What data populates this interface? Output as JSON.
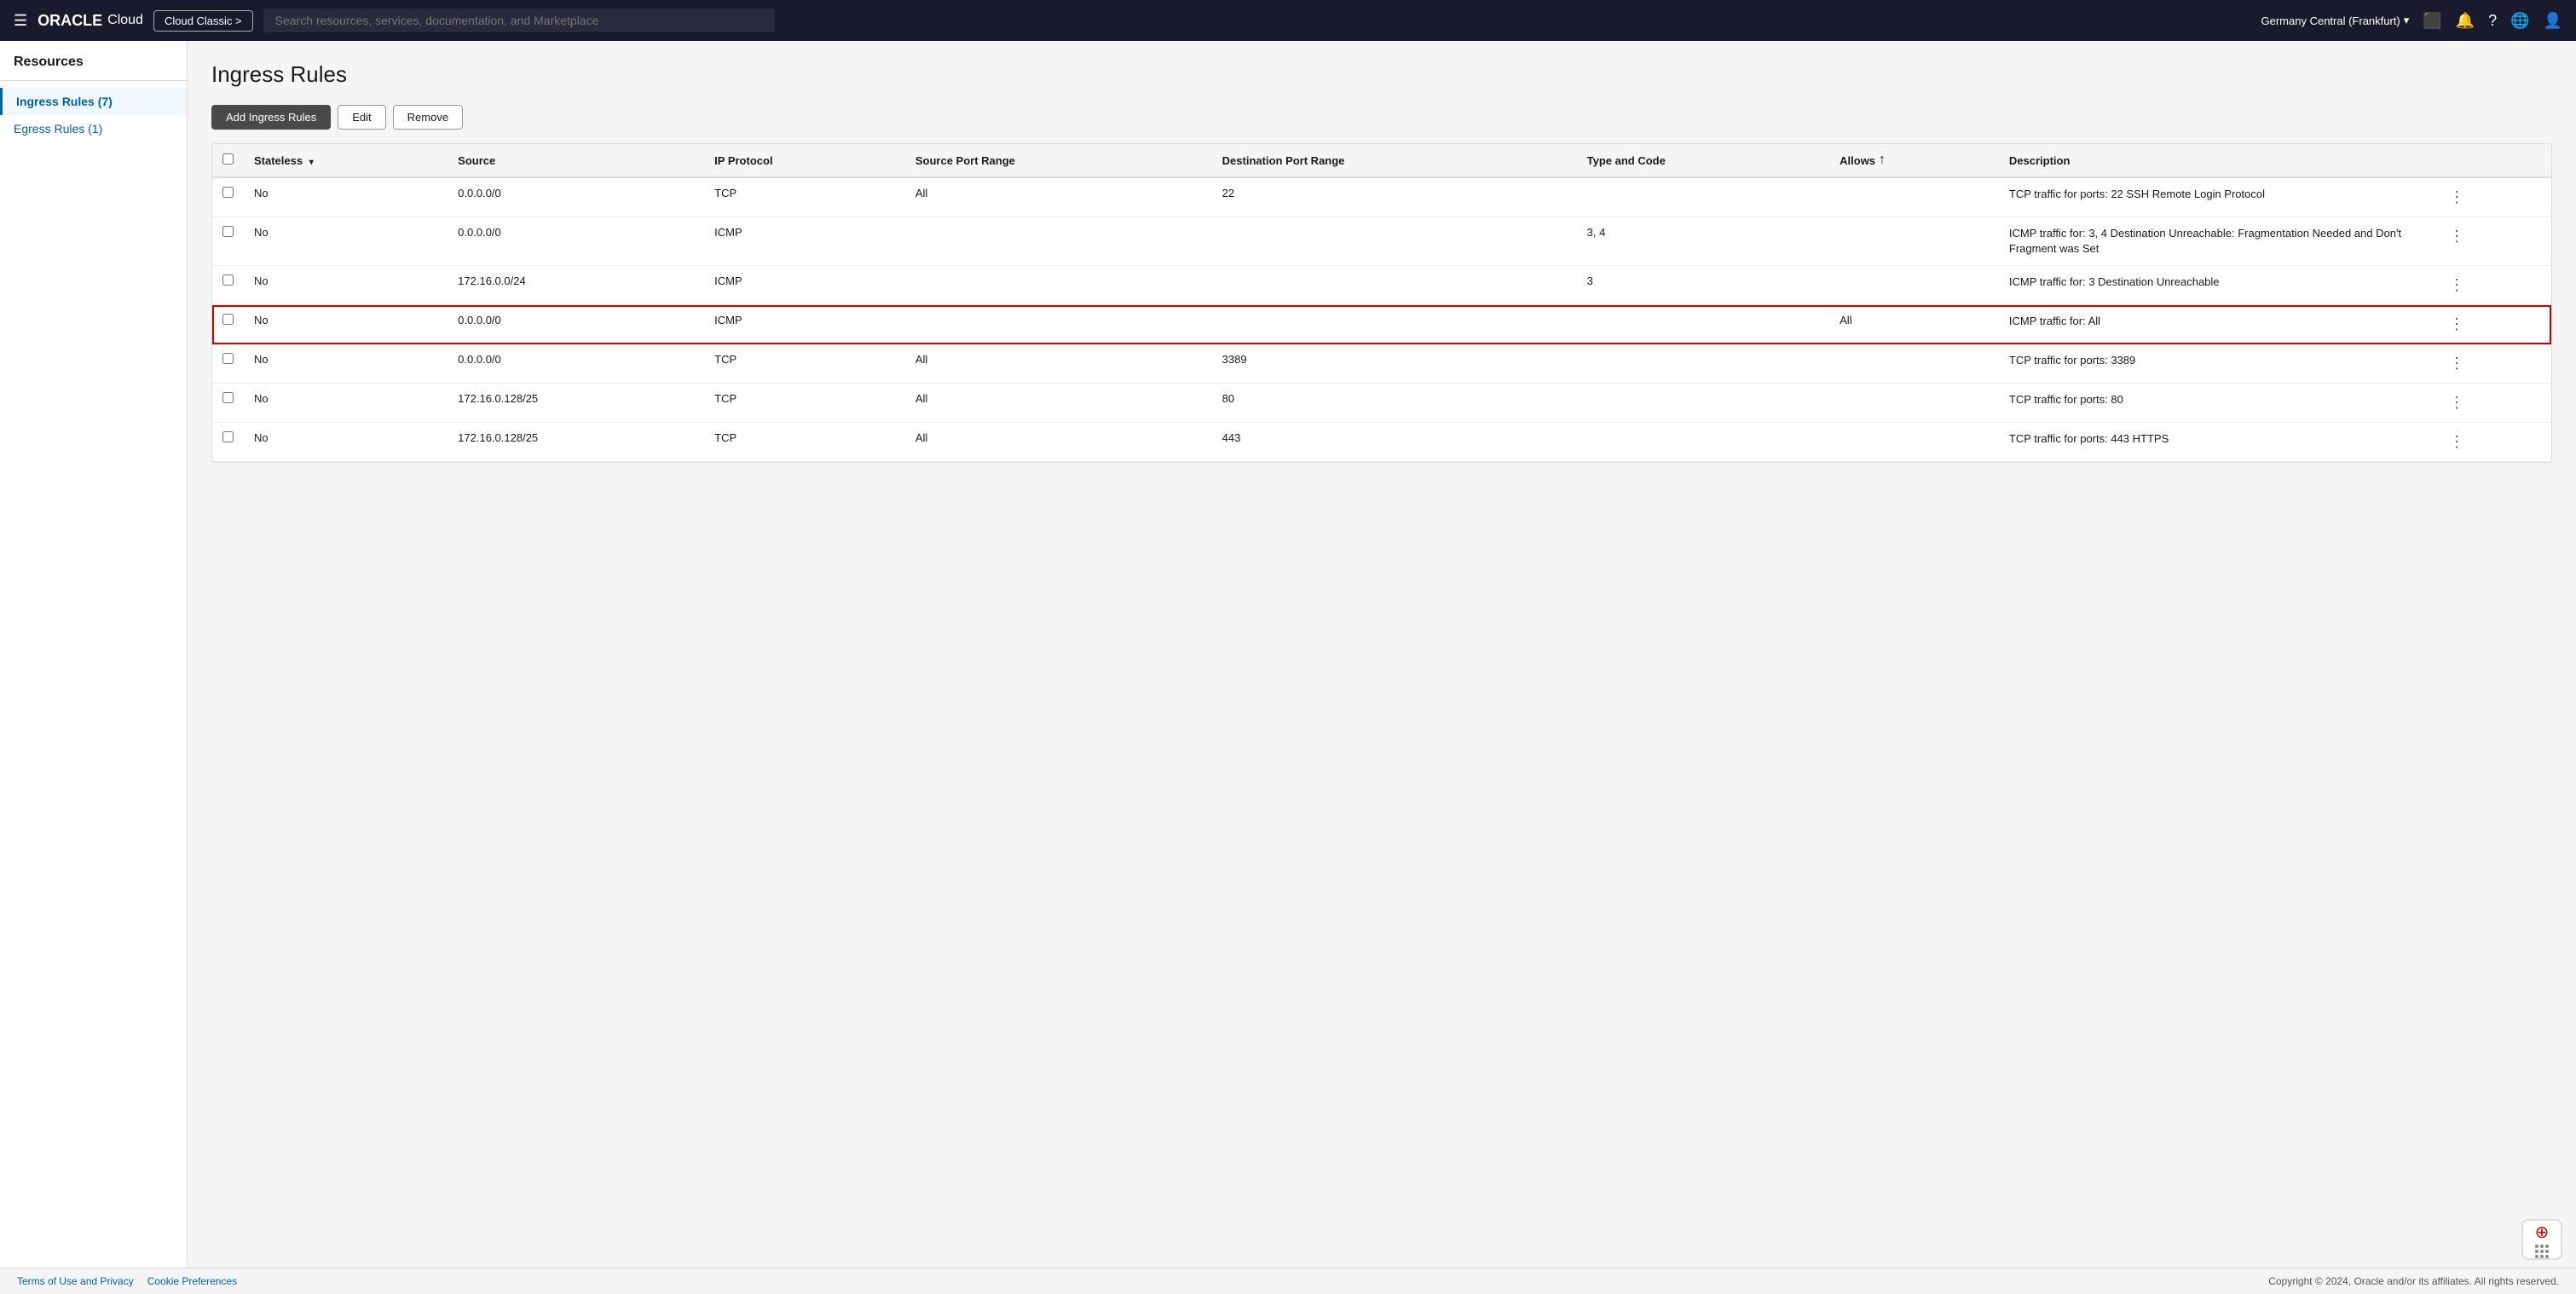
{
  "nav": {
    "hamburger": "☰",
    "oracle_logo": "ORACLE Cloud",
    "cloud_classic_btn": "Cloud Classic >",
    "search_placeholder": "Search resources, services, documentation, and Marketplace",
    "region": "Germany Central (Frankfurt)",
    "region_chevron": "▾"
  },
  "sidebar": {
    "title": "Resources",
    "items": [
      {
        "id": "ingress-rules",
        "label": "Ingress Rules (7)",
        "active": true
      },
      {
        "id": "egress-rules",
        "label": "Egress Rules (1)",
        "active": false
      }
    ]
  },
  "page": {
    "title": "Ingress Rules",
    "toolbar": {
      "add_label": "Add Ingress Rules",
      "edit_label": "Edit",
      "remove_label": "Remove"
    },
    "table": {
      "columns": [
        {
          "id": "checkbox",
          "label": ""
        },
        {
          "id": "stateless",
          "label": "Stateless",
          "sortable": true
        },
        {
          "id": "source",
          "label": "Source"
        },
        {
          "id": "ip_protocol",
          "label": "IP Protocol"
        },
        {
          "id": "source_port_range",
          "label": "Source Port Range"
        },
        {
          "id": "destination_port_range",
          "label": "Destination Port Range"
        },
        {
          "id": "type_and_code",
          "label": "Type and Code"
        },
        {
          "id": "allows",
          "label": "Allows"
        },
        {
          "id": "description",
          "label": "Description"
        },
        {
          "id": "actions",
          "label": ""
        }
      ],
      "rows": [
        {
          "id": 1,
          "stateless": "No",
          "source": "0.0.0.0/0",
          "ip_protocol": "TCP",
          "source_port_range": "All",
          "destination_port_range": "22",
          "type_and_code": "",
          "allows": "",
          "description": "TCP traffic for ports: 22 SSH Remote Login Protocol",
          "highlighted": false
        },
        {
          "id": 2,
          "stateless": "No",
          "source": "0.0.0.0/0",
          "ip_protocol": "ICMP",
          "source_port_range": "",
          "destination_port_range": "",
          "type_and_code": "3, 4",
          "allows": "",
          "description": "ICMP traffic for: 3, 4 Destination Unreachable: Fragmentation Needed and Don't Fragment was Set",
          "highlighted": false
        },
        {
          "id": 3,
          "stateless": "No",
          "source": "172.16.0.0/24",
          "ip_protocol": "ICMP",
          "source_port_range": "",
          "destination_port_range": "",
          "type_and_code": "3",
          "allows": "",
          "description": "ICMP traffic for: 3 Destination Unreachable",
          "highlighted": false
        },
        {
          "id": 4,
          "stateless": "No",
          "source": "0.0.0.0/0",
          "ip_protocol": "ICMP",
          "source_port_range": "",
          "destination_port_range": "",
          "type_and_code": "",
          "allows": "All",
          "description": "ICMP traffic for: All",
          "highlighted": true
        },
        {
          "id": 5,
          "stateless": "No",
          "source": "0.0.0.0/0",
          "ip_protocol": "TCP",
          "source_port_range": "All",
          "destination_port_range": "3389",
          "type_and_code": "",
          "allows": "",
          "description": "TCP traffic for ports: 3389",
          "highlighted": false
        },
        {
          "id": 6,
          "stateless": "No",
          "source": "172.16.0.128/25",
          "ip_protocol": "TCP",
          "source_port_range": "All",
          "destination_port_range": "80",
          "type_and_code": "",
          "allows": "",
          "description": "TCP traffic for ports: 80",
          "highlighted": false
        },
        {
          "id": 7,
          "stateless": "No",
          "source": "172.16.0.128/25",
          "ip_protocol": "TCP",
          "source_port_range": "All",
          "destination_port_range": "443",
          "type_and_code": "",
          "allows": "",
          "description": "TCP traffic for ports: 443 HTTPS",
          "highlighted": false
        }
      ]
    }
  },
  "footer": {
    "links": [
      {
        "label": "Terms of Use and Privacy"
      },
      {
        "label": "Cookie Preferences"
      }
    ],
    "copyright": "Copyright © 2024, Oracle and/or its affiliates. All rights reserved."
  }
}
